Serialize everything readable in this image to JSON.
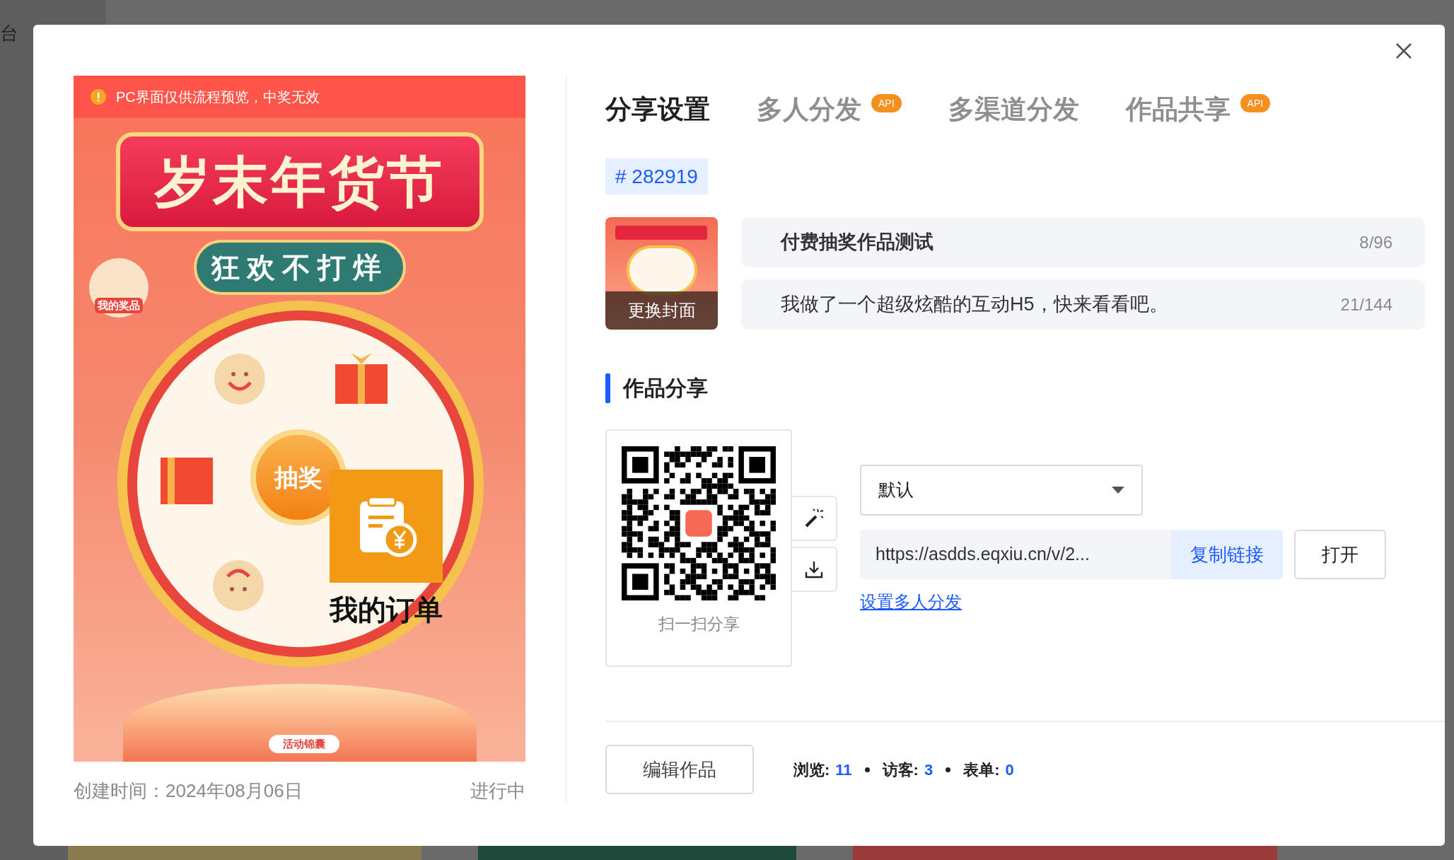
{
  "background": {
    "sidebar_text": "台"
  },
  "preview": {
    "notice": "PC界面仅供流程预览，中奖无效",
    "banner_title": "岁末年货节",
    "subtitle": "狂欢不打烊",
    "prizes_button": "我的奖品",
    "draw_button": "抽奖",
    "orders_button": "我的订单",
    "tips_badge": "活动锦囊"
  },
  "created": "创建时间：2024年08月06日",
  "status": "进行中",
  "tabs": [
    {
      "label": "分享设置",
      "selected": true
    },
    {
      "label": "多人分发",
      "selected": false,
      "badge": "API"
    },
    {
      "label": "多渠道分发",
      "selected": false
    },
    {
      "label": "作品共享",
      "selected": false,
      "badge": "API"
    }
  ],
  "work_id": "# 282919",
  "cover": {
    "button": "更换封面"
  },
  "title_field": {
    "value": "付费抽奖作品测试",
    "count": "8/96"
  },
  "description_field": {
    "value": "我做了一个超级炫酷的互动H5，快来看看吧。",
    "count": "21/144"
  },
  "section_title": "作品分享",
  "qr": {
    "caption": "扫一扫分享"
  },
  "channel_select": {
    "value": "默认"
  },
  "url_field": {
    "value": "https://asdds.eqxiu.cn/v/2..."
  },
  "copy_button": "复制链接",
  "open_button": "打开",
  "multi_link": "设置多人分发",
  "edit_button": "编辑作品",
  "stats": [
    {
      "label": "浏览:",
      "value": "11"
    },
    {
      "label": "访客:",
      "value": "3"
    },
    {
      "label": "表单:",
      "value": "0"
    }
  ]
}
